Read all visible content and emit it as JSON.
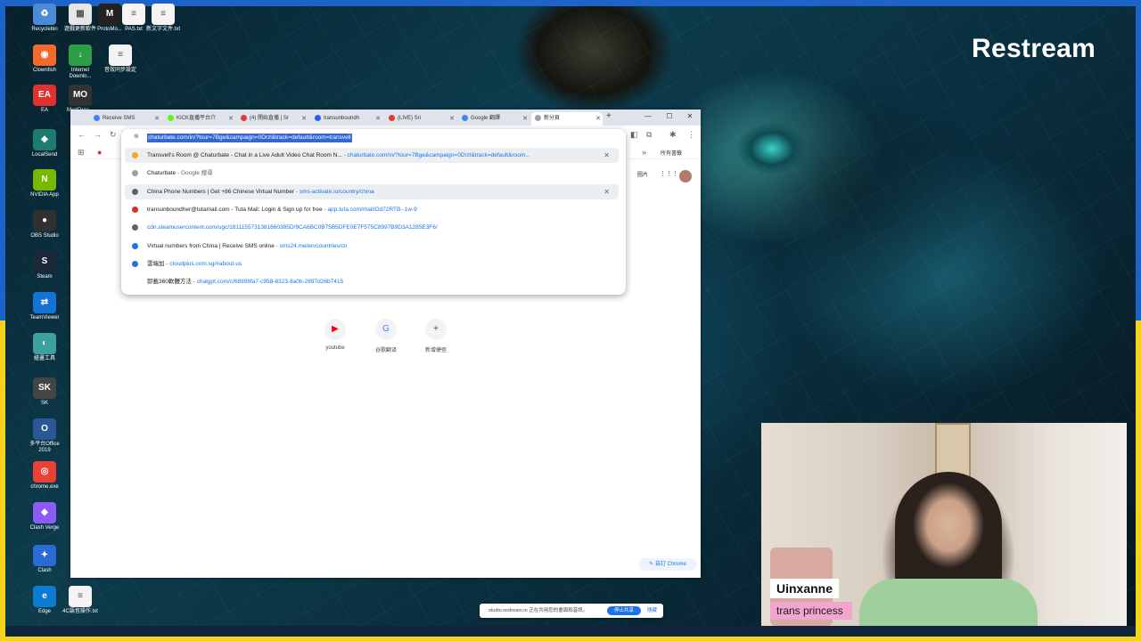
{
  "brand": "Restream",
  "desktop_icons": [
    {
      "label": "Recyclebin",
      "color": "#4a8ad6",
      "glyph": "♻"
    },
    {
      "label": "遊戲更新軟件",
      "color": "#e6e6e6",
      "glyph": "▦"
    },
    {
      "label": "ProtoMo...",
      "color": "#222222",
      "glyph": "M"
    },
    {
      "label": "PAS.txt",
      "color": "#f4f4f4",
      "glyph": "≡"
    },
    {
      "label": "新文字文件.txt",
      "color": "#f4f4f4",
      "glyph": "≡"
    },
    {
      "label": "Clownfish",
      "color": "#f36b2c",
      "glyph": "◉"
    },
    {
      "label": "Internet Downlo...",
      "color": "#2e9e46",
      "glyph": "↓"
    },
    {
      "label": "音效同步設定",
      "color": "#f4f4f4",
      "glyph": "≡"
    },
    {
      "label": "EA",
      "color": "#e03131",
      "glyph": "EA"
    },
    {
      "label": "ModOrga...",
      "color": "#333333",
      "glyph": "MO"
    },
    {
      "label": "LocalSend",
      "color": "#1f7a6f",
      "glyph": "◈"
    },
    {
      "label": "NVIDIA App",
      "color": "#76b900",
      "glyph": "N"
    },
    {
      "label": "OBS Studio",
      "color": "#303030",
      "glyph": "●"
    },
    {
      "label": "Steam",
      "color": "#1b2838",
      "glyph": "S"
    },
    {
      "label": "TeamViewer",
      "color": "#1474d6",
      "glyph": "⇄"
    },
    {
      "label": "繪畫工具",
      "color": "#3aa0a0",
      "glyph": "◐"
    },
    {
      "label": "SK",
      "color": "#444444",
      "glyph": "SK"
    },
    {
      "label": "多平台Office 2019",
      "color": "#2b5797",
      "glyph": "O"
    },
    {
      "label": "chrome.exe",
      "color": "#e94235",
      "glyph": "◎"
    },
    {
      "label": "Clash Verge",
      "color": "#8b5cf6",
      "glyph": "◆"
    },
    {
      "label": "Clash",
      "color": "#2b6bd6",
      "glyph": "✦"
    },
    {
      "label": "Edge",
      "color": "#0c7bd0",
      "glyph": "e"
    },
    {
      "label": "4C語音操作.txt",
      "color": "#f4f4f4",
      "glyph": "≡"
    }
  ],
  "browser": {
    "tabs": [
      {
        "label": "Receive SMS",
        "color": "#3b82f6"
      },
      {
        "label": "KICK直播平台介",
        "color": "#53fc18"
      },
      {
        "label": "(4) 開始直播 | Sr",
        "color": "#e53935"
      },
      {
        "label": "transunboundh",
        "color": "#2563eb"
      },
      {
        "label": "(LIVE) Sri",
        "color": "#e53935"
      },
      {
        "label": "Google 翻譯",
        "color": "#4285f4"
      },
      {
        "label": "新分頁",
        "color": "#9aa0a6"
      }
    ],
    "new_tab_symbol": "+",
    "window_controls": [
      "—",
      "☐",
      "✕"
    ],
    "bookmark_more": "所有書籤",
    "ntp": {
      "top_links": [
        "圖片",
        "⋮⋮⋮"
      ],
      "shortcuts": [
        {
          "label": "youtube",
          "icon": "youtube-icon",
          "glyph": "▶",
          "color": "#ff0000"
        },
        {
          "label": "谷歌翻译",
          "icon": "translate-icon",
          "glyph": "G",
          "color": "#4285f4"
        },
        {
          "label": "新增捷徑",
          "icon": "add-icon",
          "glyph": "+",
          "color": "#444444"
        }
      ],
      "customize": "自訂 Chrome"
    }
  },
  "omnibox": {
    "input_value": "chaturbate.com/in/?tour=7Bge&campaign=0Drzl&track=default&room=transvell",
    "suggestions": [
      {
        "title": "Transvell's Room @ Chaturbate - Chat in a Live Adult Video Chat Room N...",
        "url": "chaturbate.com/in/?tour=7Bge&campaign=0Drzl&track=default&room...",
        "icon_color": "#f6a623",
        "highlight": true,
        "removable": true
      },
      {
        "title": "Chaturbate",
        "url": "Google 搜尋",
        "icon_color": "#9aa0a6",
        "highlight": false,
        "removable": false,
        "url_is_plain": true
      },
      {
        "title": "China Phone Numbers | Get +86 Chinese Virtual Number",
        "url": "sms-activate.io/country/china",
        "icon_color": "#5f6368",
        "highlight": true,
        "removable": true
      },
      {
        "title": "transunboundher@tutamail.com - Tuta Mail: Login & Sign up for free",
        "url": "app.tuta.com/mail/Od72RTB--1w-9",
        "icon_color": "#d93025",
        "highlight": false,
        "removable": false
      },
      {
        "title": "",
        "url": "cdn.steamusercontent.com/ugc/1811155731381660385D/9CA6BC0B75B5DFE0E7F575C8997B9D3A1285E3F6/",
        "icon_color": "#5f6368",
        "highlight": false,
        "removable": false
      },
      {
        "title": "Virtual numbers from China | Receive SMS online",
        "url": "sms24.me/en/countries/cn",
        "icon_color": "#1a73e8",
        "highlight": false,
        "removable": false
      },
      {
        "title": "雲端加",
        "url": "cloudplus.com.sg/#about-us",
        "icon_color": "#1a73e8",
        "highlight": false,
        "removable": false
      },
      {
        "title": "卸載360軟體方法",
        "url": "chatgpt.com/c/68998fa7-c958-8323-8a0b-2897d26b7415",
        "icon_color": "#ffffff",
        "highlight": false,
        "removable": false
      }
    ]
  },
  "webcam": {
    "name": "Uinxanne",
    "subtitle": "trans princess"
  },
  "sharebar": {
    "message": "studio.restream.io 正在共用您的畫面和音訊。",
    "stop_label": "停止共享",
    "hide_label": "隱藏"
  },
  "colors": {
    "frame_top": "#1d63c9",
    "frame_bottom": "#f6d21c",
    "accent": "#1a73e8"
  }
}
